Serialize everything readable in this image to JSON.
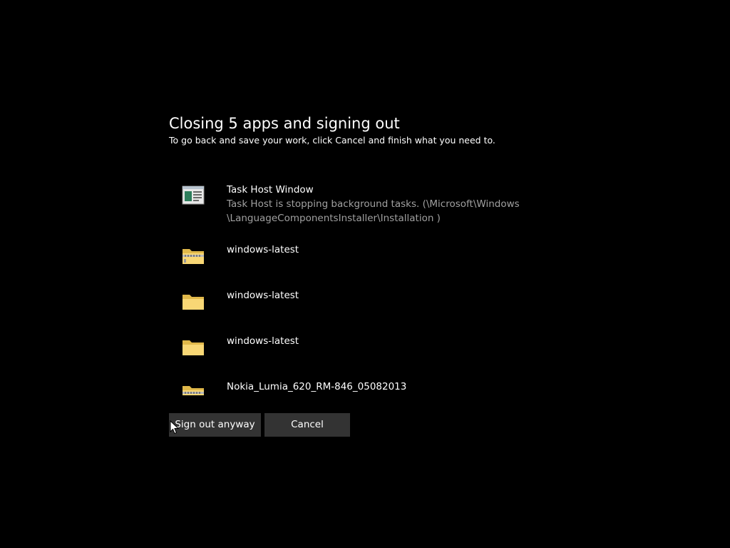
{
  "dialog": {
    "title": "Closing 5 apps and signing out",
    "subtitle": "To go back and save your work, click Cancel and finish what you need to.",
    "apps": [
      {
        "name": "Task Host Window",
        "description_line1": "Task Host is stopping background tasks. (\\Microsoft\\Windows",
        "description_line2": "\\LanguageComponentsInstaller\\Installation )",
        "icon": "task-host-icon"
      },
      {
        "name": "windows-latest",
        "icon": "zipped-folder-icon"
      },
      {
        "name": "windows-latest",
        "icon": "folder-icon"
      },
      {
        "name": "windows-latest",
        "icon": "folder-icon"
      },
      {
        "name": "Nokia_Lumia_620_RM-846_05082013",
        "icon": "zipped-folder-icon"
      }
    ],
    "buttons": {
      "sign_out": "Sign out anyway",
      "cancel": "Cancel"
    }
  },
  "colors": {
    "background": "#000000",
    "button_bg": "#333333",
    "text": "#ffffff",
    "secondary_text": "#a0a0a0",
    "folder": "#f8d775"
  }
}
